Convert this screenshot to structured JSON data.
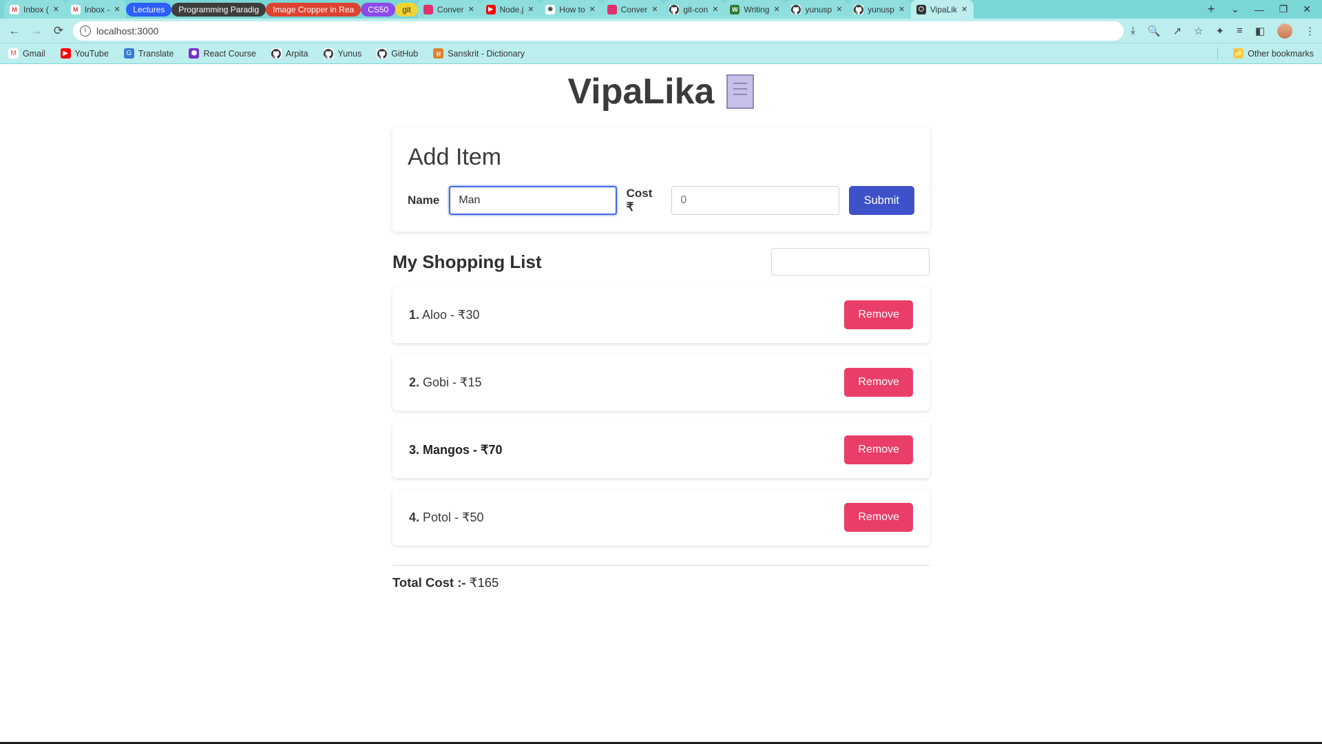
{
  "browser": {
    "url": "localhost:3000",
    "tabs": [
      {
        "title": "Inbox (",
        "kind": "normal",
        "closeable": true,
        "fav": {
          "bg": "#fff",
          "txt": "M",
          "fg": "#d44"
        }
      },
      {
        "title": "Inbox -",
        "kind": "normal",
        "closeable": true,
        "fav": {
          "bg": "#fff",
          "txt": "M",
          "fg": "#d44"
        }
      },
      {
        "title": "Lectures",
        "kind": "pill",
        "pill": "pill-blue"
      },
      {
        "title": "Programming Paradig",
        "kind": "pill",
        "pill": "pill-dark"
      },
      {
        "title": "Image Cropper in Rea",
        "kind": "pill",
        "pill": "pill-red"
      },
      {
        "title": "CS50",
        "kind": "pill",
        "pill": "pill-purple"
      },
      {
        "title": "git",
        "kind": "pill",
        "pill": "pill-yellow"
      },
      {
        "title": "Conver",
        "kind": "normal",
        "closeable": true,
        "fav": {
          "bg": "#e1306c",
          "txt": "",
          "fg": "#fff"
        }
      },
      {
        "title": "Node.j",
        "kind": "normal",
        "closeable": true,
        "fav": {
          "bg": "#f00",
          "txt": "▶",
          "fg": "#fff"
        }
      },
      {
        "title": "How to",
        "kind": "normal",
        "closeable": true,
        "fav": {
          "bg": "#fff",
          "txt": "❀",
          "fg": "#333"
        }
      },
      {
        "title": "Conver",
        "kind": "normal",
        "closeable": true,
        "fav": {
          "bg": "#e1306c",
          "txt": "",
          "fg": "#fff"
        }
      },
      {
        "title": "git-con",
        "kind": "normal",
        "closeable": true,
        "fav": {
          "bg": "#fff",
          "txt": "",
          "fg": "#333",
          "gh": true
        }
      },
      {
        "title": "Writing",
        "kind": "normal",
        "closeable": true,
        "fav": {
          "bg": "#2f7a2f",
          "txt": "W",
          "fg": "#fff"
        }
      },
      {
        "title": "yunusp",
        "kind": "normal",
        "closeable": true,
        "fav": {
          "bg": "#fff",
          "txt": "",
          "fg": "#333",
          "gh": true
        }
      },
      {
        "title": "yunusp",
        "kind": "normal",
        "closeable": true,
        "fav": {
          "bg": "#fff",
          "txt": "",
          "fg": "#333",
          "gh": true
        }
      },
      {
        "title": "VipaLik",
        "kind": "normal",
        "closeable": true,
        "active": true,
        "fav": {
          "bg": "#333",
          "txt": "⬡",
          "fg": "#fff"
        }
      }
    ],
    "bookmarks": [
      {
        "label": "Gmail",
        "icon": {
          "bg": "#fff",
          "txt": "M",
          "fg": "#d44"
        }
      },
      {
        "label": "YouTube",
        "icon": {
          "bg": "#f00",
          "txt": "▶",
          "fg": "#fff"
        }
      },
      {
        "label": "Translate",
        "icon": {
          "bg": "#3a7bd5",
          "txt": "G",
          "fg": "#fff"
        }
      },
      {
        "label": "React Course",
        "icon": {
          "bg": "#7b2fc9",
          "txt": "⬢",
          "fg": "#fff"
        }
      },
      {
        "label": "Arpita",
        "icon": {
          "bg": "#fff",
          "txt": "",
          "fg": "#333",
          "gh": true
        }
      },
      {
        "label": "Yunus",
        "icon": {
          "bg": "#fff",
          "txt": "",
          "fg": "#333",
          "gh": true
        }
      },
      {
        "label": "GitHub",
        "icon": {
          "bg": "#fff",
          "txt": "",
          "fg": "#333",
          "gh": true
        }
      },
      {
        "label": "Sanskrit - Dictionary",
        "icon": {
          "bg": "#e0802a",
          "txt": "स",
          "fg": "#fff"
        }
      }
    ],
    "other_bookmarks_label": "Other bookmarks"
  },
  "app": {
    "title": "VipaLika",
    "add_form": {
      "heading": "Add Item",
      "name_label": "Name",
      "name_value": "Man",
      "cost_label": "Cost ₹",
      "cost_placeholder": "0",
      "cost_value": "",
      "submit_label": "Submit"
    },
    "list": {
      "heading": "My Shopping List",
      "filter_value": "",
      "items": [
        {
          "num": "1.",
          "text": "Aloo - ₹30",
          "highlight": false
        },
        {
          "num": "2.",
          "text": "Gobi - ₹15",
          "highlight": false
        },
        {
          "num": "3.",
          "text": "Mangos - ₹70",
          "highlight": true
        },
        {
          "num": "4.",
          "text": "Potol - ₹50",
          "highlight": false
        }
      ],
      "remove_label": "Remove"
    },
    "total": {
      "label": "Total Cost :-",
      "value": "₹165"
    }
  }
}
